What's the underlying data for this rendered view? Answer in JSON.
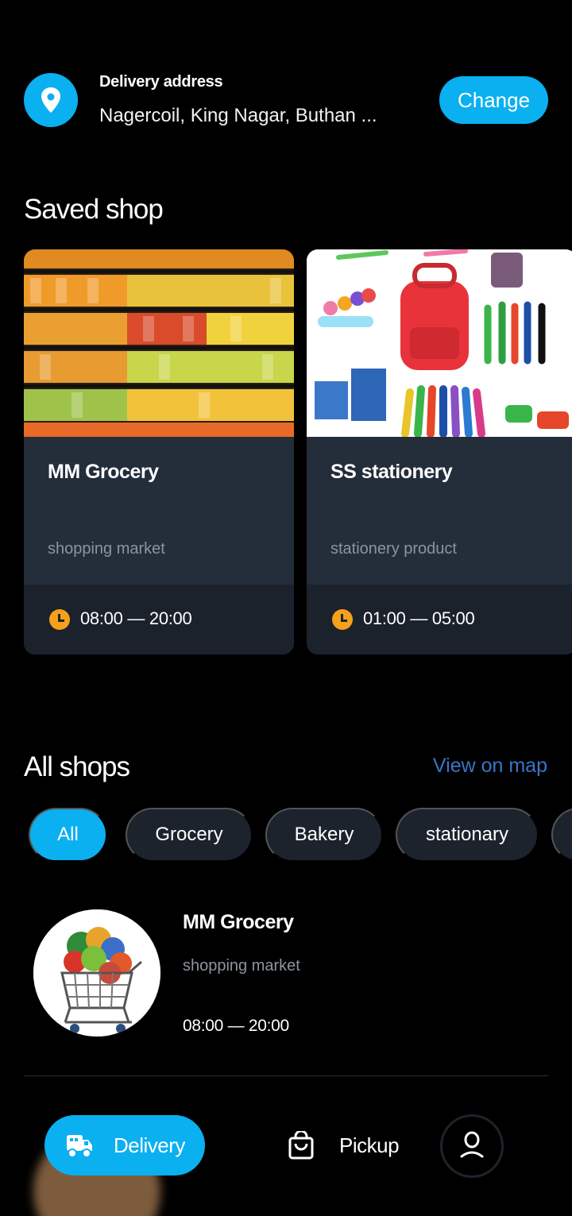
{
  "header": {
    "title": "Delivery address",
    "address": "Nagercoil, King Nagar, Buthan ...",
    "change_label": "Change",
    "pin_icon": "location-pin-icon"
  },
  "saved": {
    "title": "Saved shop",
    "shops": [
      {
        "name": "MM Grocery",
        "category": "shopping market",
        "hours": "08:00 — 20:00"
      },
      {
        "name": "SS stationery",
        "category": "stationery product",
        "hours": "01:00 — 05:00"
      }
    ]
  },
  "all": {
    "title": "All shops",
    "view_map": "View on map",
    "chips": [
      "All",
      "Grocery",
      "Bakery",
      "stationary"
    ],
    "shops": [
      {
        "name": "MM Grocery",
        "category": "shopping market",
        "hours": "08:00 — 20:00"
      }
    ]
  },
  "nav": {
    "delivery": "Delivery",
    "pickup": "Pickup"
  },
  "colors": {
    "accent": "#0ab0f0",
    "card": "#242d3a",
    "clock": "#f5a11c",
    "link": "#3a74c9"
  }
}
